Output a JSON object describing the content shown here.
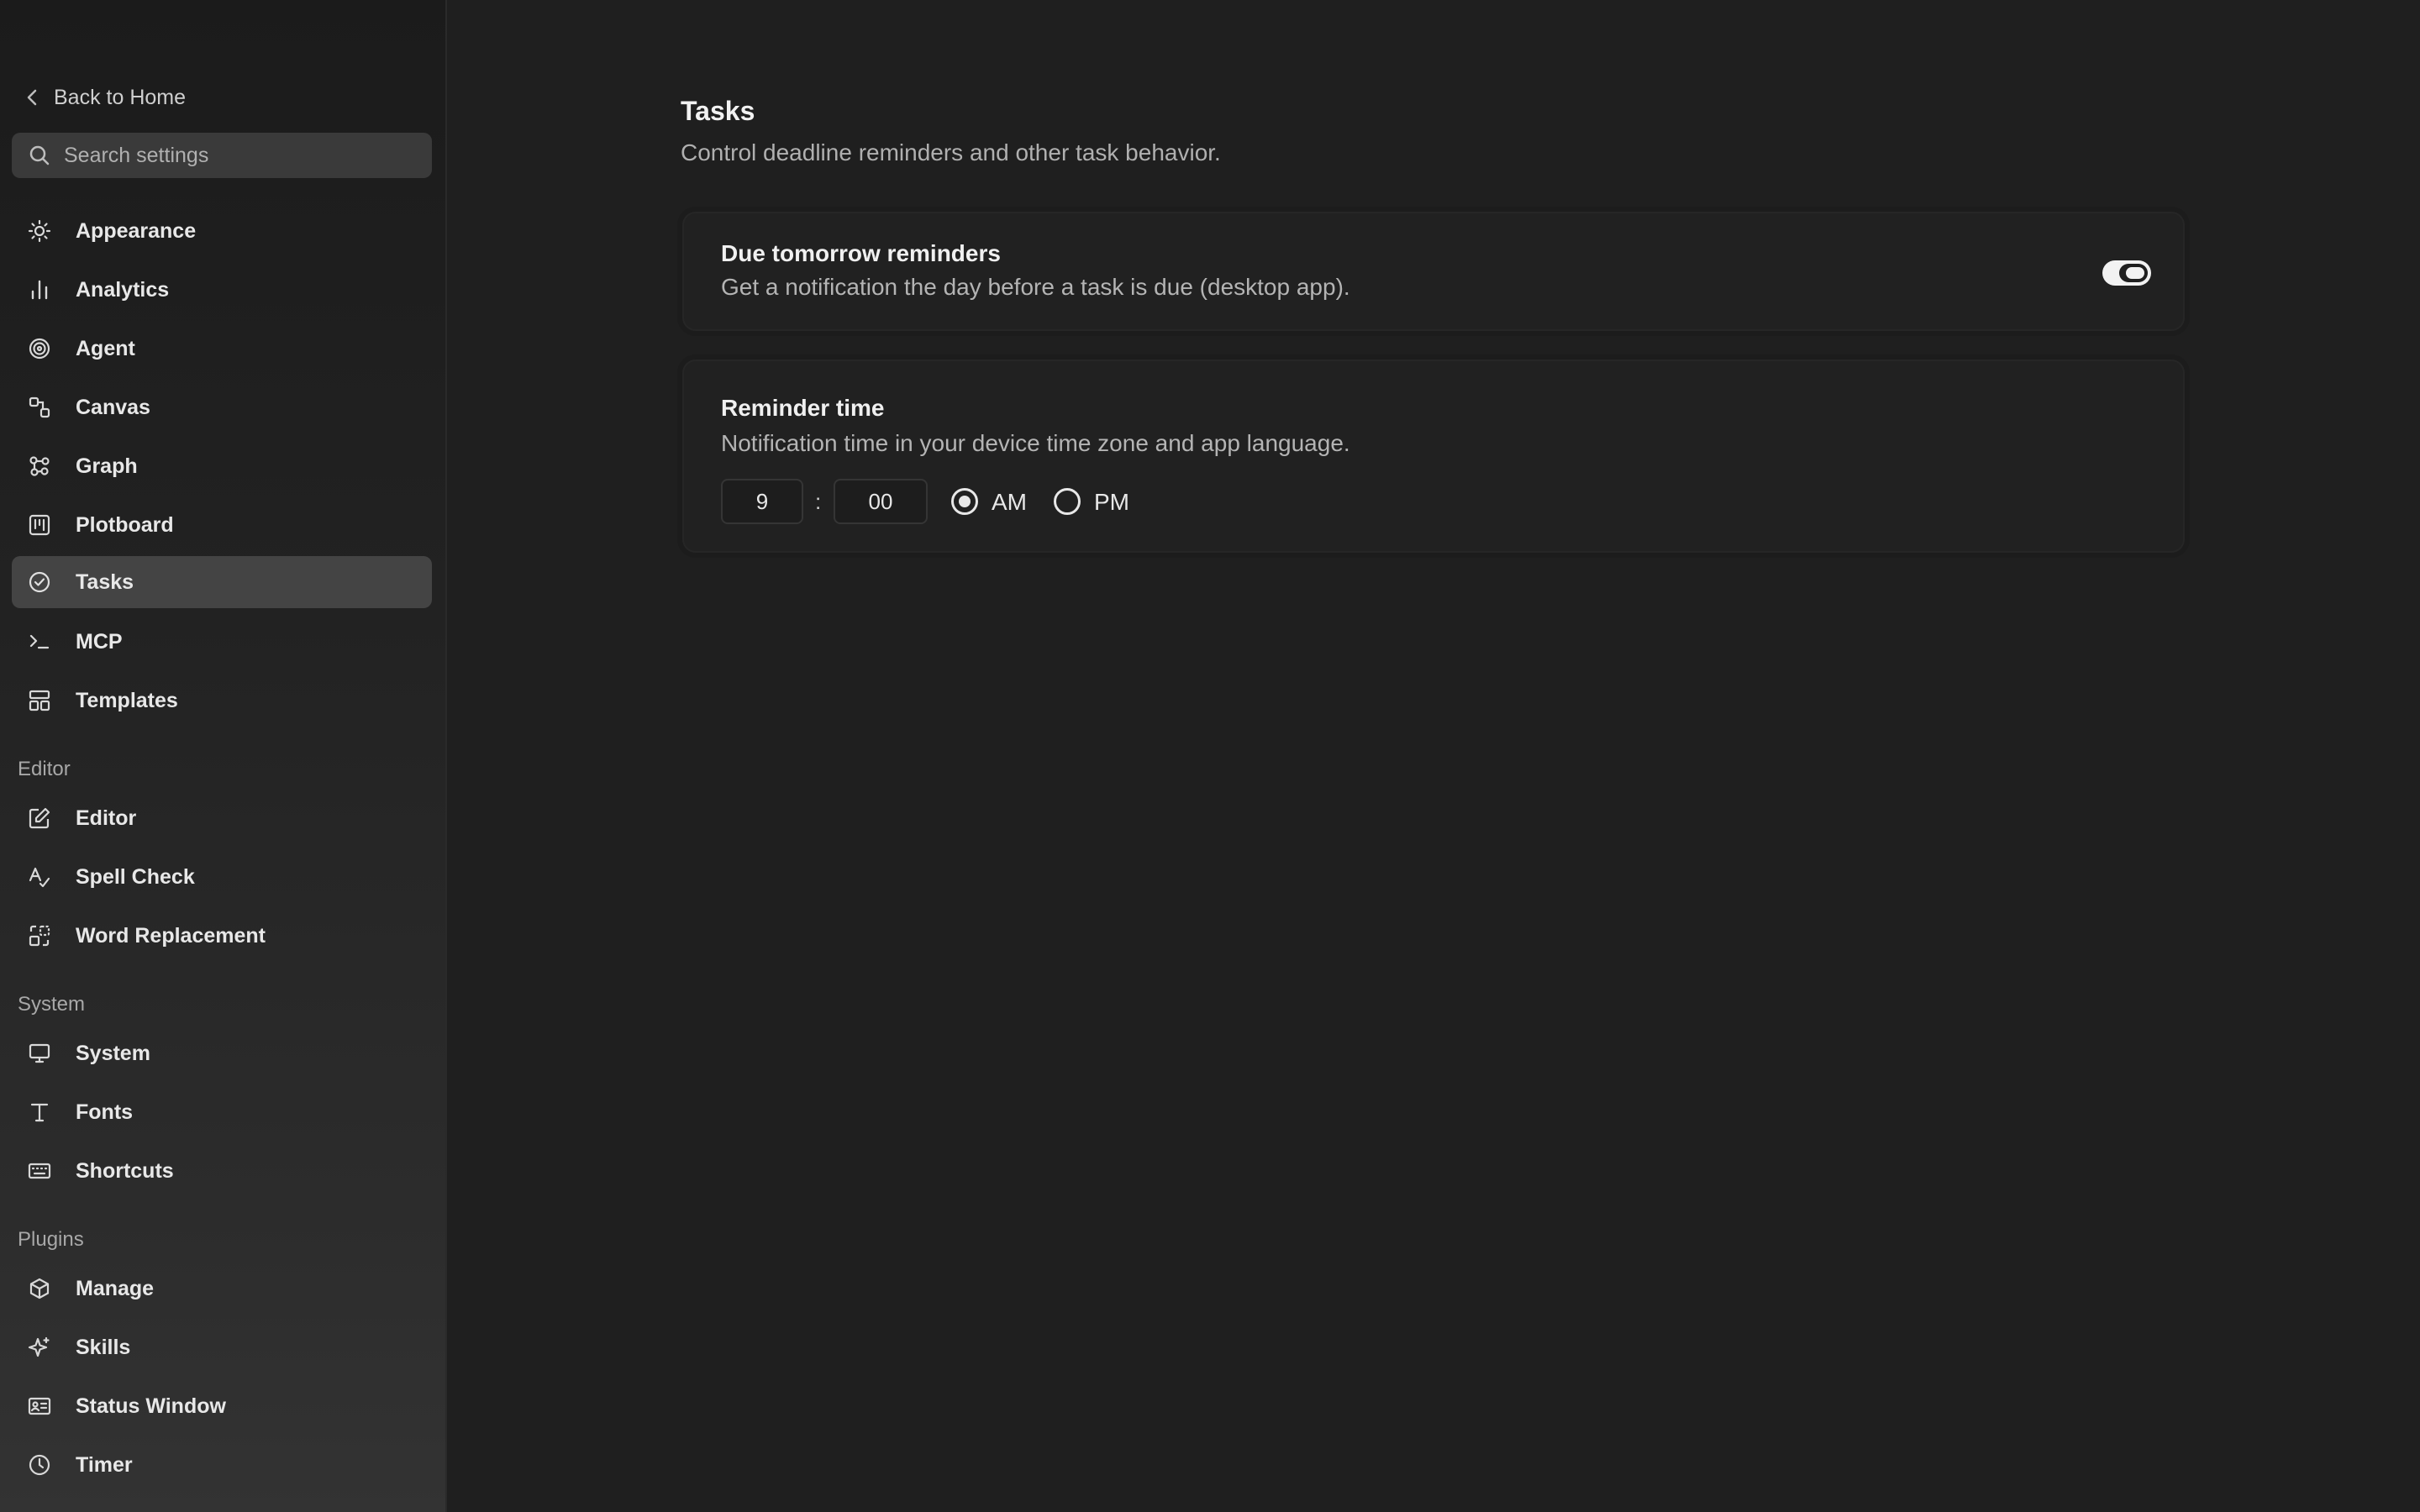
{
  "sidebar": {
    "back_label": "Back to Home",
    "search_placeholder": "Search settings",
    "items": [
      {
        "label": "Appearance",
        "icon": "sun-icon"
      },
      {
        "label": "Analytics",
        "icon": "bar-chart-icon"
      },
      {
        "label": "Agent",
        "icon": "spiral-icon"
      },
      {
        "label": "Canvas",
        "icon": "shapes-icon"
      },
      {
        "label": "Graph",
        "icon": "graph-nodes-icon"
      },
      {
        "label": "Plotboard",
        "icon": "kanban-icon"
      },
      {
        "label": "Tasks",
        "icon": "check-circle-icon",
        "active": true
      },
      {
        "label": "MCP",
        "icon": "terminal-icon"
      },
      {
        "label": "Templates",
        "icon": "layout-template-icon"
      }
    ],
    "editor_group": {
      "heading": "Editor",
      "items": [
        {
          "label": "Editor",
          "icon": "edit-icon"
        },
        {
          "label": "Spell Check",
          "icon": "spell-check-icon"
        },
        {
          "label": "Word Replacement",
          "icon": "replace-icon"
        }
      ]
    },
    "system_group": {
      "heading": "System",
      "items": [
        {
          "label": "System",
          "icon": "monitor-icon"
        },
        {
          "label": "Fonts",
          "icon": "type-icon"
        },
        {
          "label": "Shortcuts",
          "icon": "keyboard-icon"
        }
      ]
    },
    "plugins_group": {
      "heading": "Plugins",
      "items": [
        {
          "label": "Manage",
          "icon": "package-icon"
        },
        {
          "label": "Skills",
          "icon": "sparkle-icon"
        },
        {
          "label": "Status Window",
          "icon": "id-card-icon"
        },
        {
          "label": "Timer",
          "icon": "clock-icon"
        }
      ]
    }
  },
  "main": {
    "title": "Tasks",
    "subtitle": "Control deadline reminders and other task behavior.",
    "due_card": {
      "title": "Due tomorrow reminders",
      "description": "Get a notification the day before a task is due (desktop app).",
      "enabled": true
    },
    "time_card": {
      "title": "Reminder time",
      "description": "Notification time in your device time zone and app language.",
      "hour": "9",
      "separator": ":",
      "minute": "00",
      "am_label": "AM",
      "pm_label": "PM",
      "selected": "AM"
    }
  },
  "colors": {
    "background": "#1f1f1f",
    "sidebar_active": "#444444",
    "text_primary": "#f0f0f0",
    "text_secondary": "#b0b0b0"
  }
}
